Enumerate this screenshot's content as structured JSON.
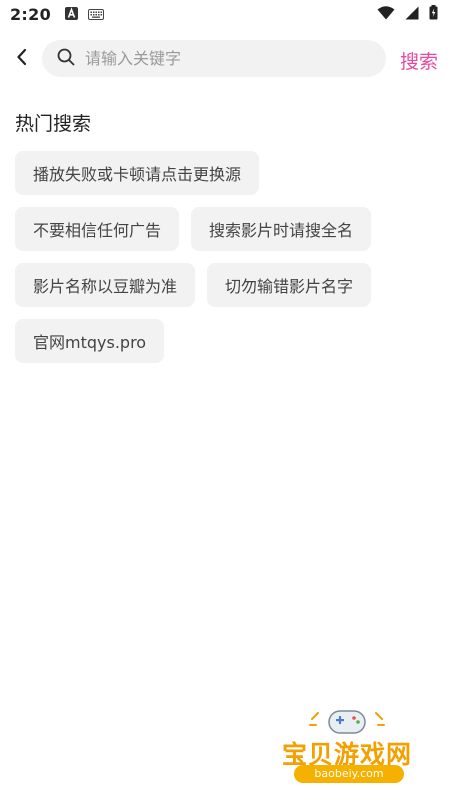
{
  "status_bar": {
    "time": "2:20"
  },
  "search": {
    "placeholder": "请输入关键字",
    "value": "",
    "action_label": "搜索"
  },
  "hot_search": {
    "title": "热门搜索",
    "tags": [
      "播放失败或卡顿请点击更换源",
      "不要相信任何广告",
      "搜索影片时请搜全名",
      "影片名称以豆瓣为准",
      "切勿输错影片名字",
      "官网mtqys.pro"
    ]
  },
  "watermark": {
    "name": "宝贝游戏网",
    "url": "baobeiy.com"
  }
}
